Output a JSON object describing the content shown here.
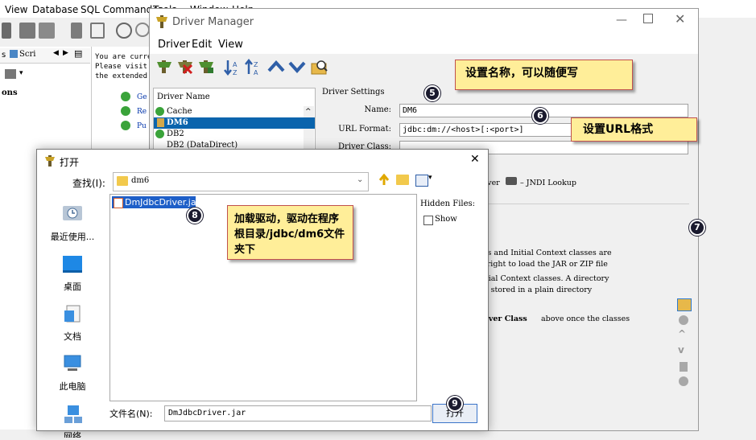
{
  "app": {
    "menu": [
      "View",
      "Database",
      "SQL Commander",
      "Tools",
      "Window",
      "Help"
    ],
    "left_tab": "Scri",
    "left_tree_item": "ons",
    "welcome_lines": [
      "You are curre",
      "Please visit",
      "the extended"
    ],
    "welcome_links": [
      "Ge",
      "Re",
      "Pu"
    ]
  },
  "driver_manager": {
    "title": "Driver Manager",
    "menu": [
      "Driver",
      "Edit",
      "View"
    ],
    "list_header": "Driver Name",
    "drivers": [
      "Cache",
      "DM6",
      "DB2",
      "DB2 (DataDirect)"
    ],
    "selected_driver": "DM6",
    "settings_header": "Driver Settings",
    "name_label": "Name:",
    "name_value": "DM6",
    "url_label": "URL Format:",
    "url_value": "jdbc:dm://<host>[:<port>]",
    "class_label": "Driver Class:",
    "class_value": "",
    "jndi_text": "Driver",
    "jndi_text2": "– JNDI Lookup",
    "desc_lines": [
      "vers and Initial Context classes are",
      "he right to load the JAR or ZIP file",
      "Initial Context classes. A directory",
      "e is stored in a plain directory"
    ],
    "desc_bold_a": "Driver Class",
    "desc_tail": "above once the classes"
  },
  "callouts": {
    "name_tip": "设置名称，可以随便写",
    "url_tip": "设置URL格式",
    "driver_tip": "加载驱动，驱动在程序根目录/jdbc/dm6文件夹下"
  },
  "badges": [
    "5",
    "6",
    "7",
    "8",
    "9"
  ],
  "open_dialog": {
    "title": "打开",
    "look_in_label": "查找(I):",
    "look_in_value": "dm6",
    "places": [
      "最近使用...",
      "桌面",
      "文档",
      "此电脑",
      "网络"
    ],
    "files": [
      "DmJdbcDriver.jar"
    ],
    "hidden_files_label": "Hidden Files:",
    "show_label": "Show",
    "file_name_label": "文件名(N):",
    "file_name_value": "DmJdbcDriver.jar",
    "open_button": "打开"
  }
}
